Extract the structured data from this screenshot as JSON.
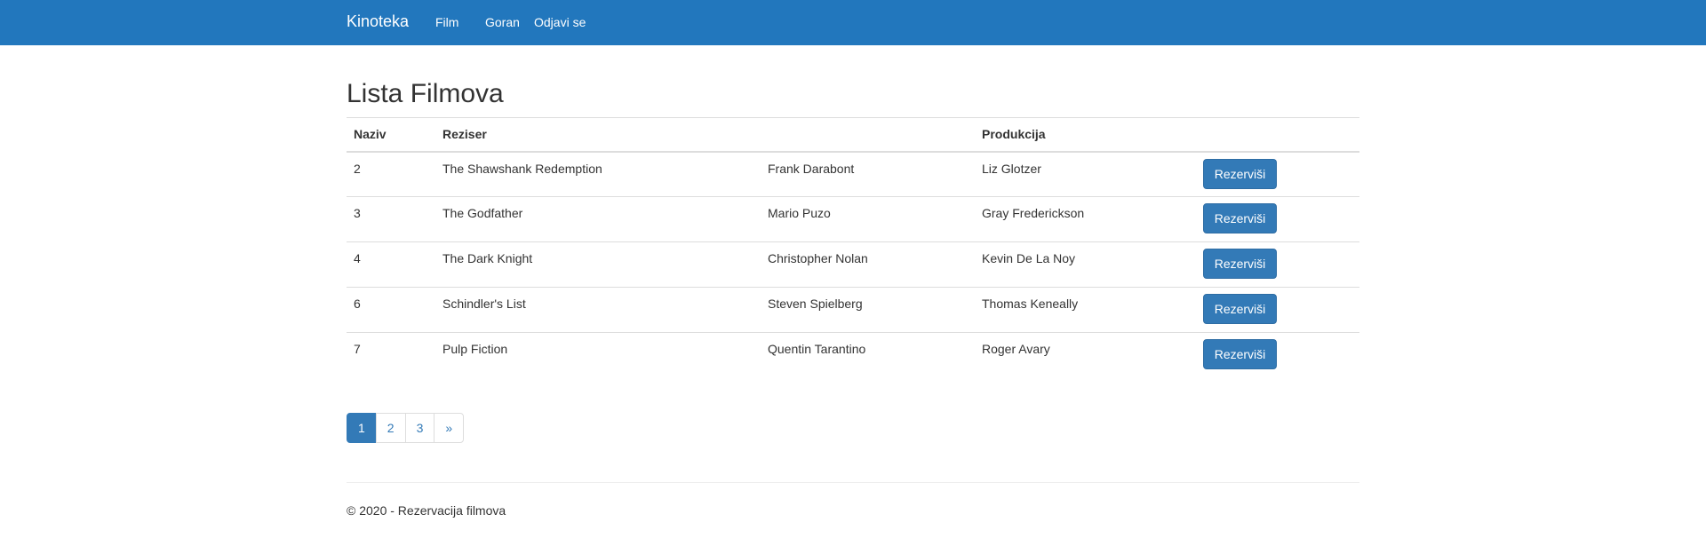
{
  "navbar": {
    "brand": "Kinoteka",
    "links": [
      {
        "label": "Film"
      },
      {
        "label": "Goran"
      },
      {
        "label": "Odjavi se"
      }
    ],
    "background_color": "#2277bd"
  },
  "page": {
    "title": "Lista Filmova"
  },
  "table": {
    "headers": [
      "Naziv",
      "Reziser",
      "",
      "Produkcija",
      ""
    ],
    "rows": [
      {
        "id": "2",
        "title": "The Shawshank Redemption",
        "director": "Frank Darabont",
        "producer": "Liz Glotzer",
        "action": "Rezerviši"
      },
      {
        "id": "3",
        "title": "The Godfather",
        "director": "Mario Puzo",
        "producer": "Gray Frederickson",
        "action": "Rezerviši"
      },
      {
        "id": "4",
        "title": "The Dark Knight",
        "director": "Christopher Nolan",
        "producer": "Kevin De La Noy",
        "action": "Rezerviši"
      },
      {
        "id": "6",
        "title": "Schindler's List",
        "director": "Steven Spielberg",
        "producer": "Thomas Keneally",
        "action": "Rezerviši"
      },
      {
        "id": "7",
        "title": "Pulp Fiction",
        "director": "Quentin Tarantino",
        "producer": "Roger Avary",
        "action": "Rezerviši"
      }
    ],
    "button_color": "#337ab7"
  },
  "pagination": {
    "pages": [
      "1",
      "2",
      "3",
      "»"
    ],
    "active": "1"
  },
  "footer": {
    "text": "© 2020 - Rezervacija filmova"
  }
}
